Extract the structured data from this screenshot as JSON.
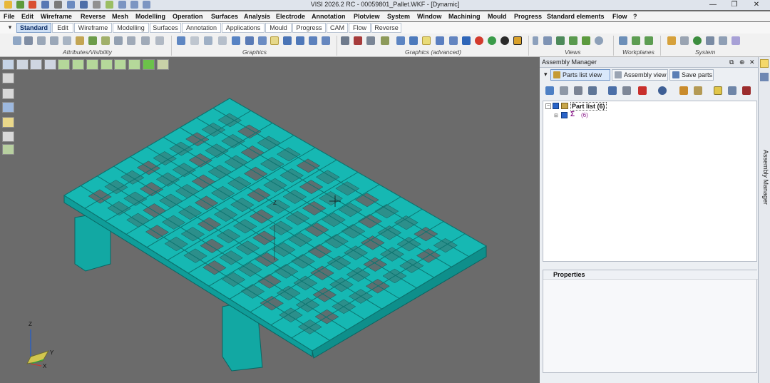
{
  "window": {
    "title": "VISI 2026.2 RC - 00059801_Pallet.WKF - [Dynamic]",
    "minimize": "—",
    "maximize": "❐",
    "close": "✕"
  },
  "menu": [
    "File",
    "Edit",
    "Wireframe",
    "Reverse",
    "Mesh",
    "Modelling",
    "Operation",
    "Surfaces",
    "Analysis",
    "Electrode",
    "Annotation",
    "Plotview",
    "System",
    "Window",
    "Machining",
    "Mould",
    "Progress",
    "Standard elements",
    "Flow",
    "?"
  ],
  "tabs": [
    "Standard",
    "Edit",
    "Wireframe",
    "Modelling",
    "Surfaces",
    "Annotation",
    "Applications",
    "Mould",
    "Progress",
    "CAM",
    "Flow",
    "Reverse"
  ],
  "active_tab": "Standard",
  "ribbon_groups": [
    "Attributes/Visibility",
    "Graphics",
    "Graphics (advanced)",
    "Views",
    "Workplanes",
    "System"
  ],
  "viewport": {
    "axis_labels": {
      "z": "Z",
      "y": "Y",
      "x": "X"
    },
    "model_color": "#15b7b2"
  },
  "assembly_manager": {
    "title": "Assembly Manager",
    "tabs": [
      "Parts list view",
      "Assembly view",
      "Save parts"
    ],
    "active_tab": "Parts list view",
    "tree": [
      {
        "label": "Part list (6)",
        "checked": true,
        "expanded": true
      },
      {
        "label": "(6)",
        "checked": true,
        "symbol": "Σ"
      }
    ],
    "properties_title": "Properties"
  },
  "side_panel_label": "Assembly Manager",
  "colors": {
    "accent": "#cfe0f5",
    "model": "#15b7b2",
    "sum_text": "#8a1b8a"
  }
}
